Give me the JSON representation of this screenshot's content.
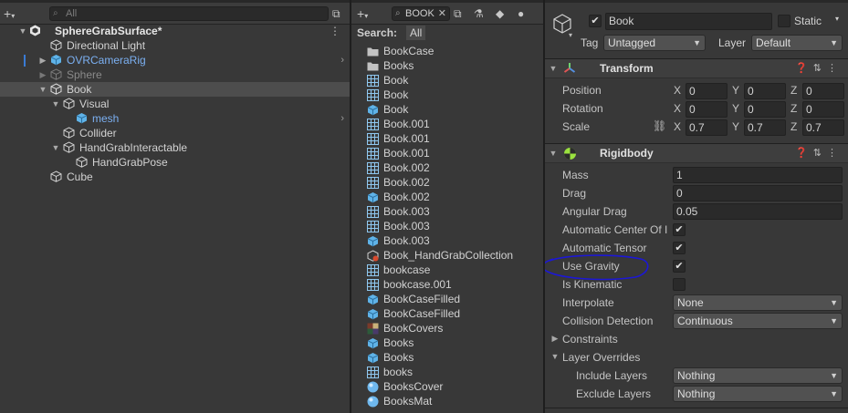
{
  "hierarchy": {
    "search_placeholder": "All",
    "scene_name": "SphereGrabSurface*",
    "items": [
      {
        "label": "Directional Light"
      },
      {
        "label": "OVRCameraRig"
      },
      {
        "label": "Sphere"
      },
      {
        "label": "Book"
      },
      {
        "label": "Visual"
      },
      {
        "label": "mesh"
      },
      {
        "label": "Collider"
      },
      {
        "label": "HandGrabInteractable"
      },
      {
        "label": "HandGrabPose"
      },
      {
        "label": "Cube"
      }
    ]
  },
  "project": {
    "search_value": "BOOK",
    "search_label": "Search:",
    "search_scope": "All",
    "items": [
      {
        "label": "BookCase",
        "icon": "folder-icon"
      },
      {
        "label": "Books",
        "icon": "folder-icon"
      },
      {
        "label": "Book",
        "icon": "mesh-grid-icon"
      },
      {
        "label": "Book",
        "icon": "mesh-grid-icon"
      },
      {
        "label": "Book",
        "icon": "prefab-cube-icon"
      },
      {
        "label": "Book.001",
        "icon": "mesh-grid-icon"
      },
      {
        "label": "Book.001",
        "icon": "mesh-grid-icon"
      },
      {
        "label": "Book.001",
        "icon": "mesh-grid-icon"
      },
      {
        "label": "Book.002",
        "icon": "mesh-grid-icon"
      },
      {
        "label": "Book.002",
        "icon": "mesh-grid-icon"
      },
      {
        "label": "Book.002",
        "icon": "prefab-cube-icon"
      },
      {
        "label": "Book.003",
        "icon": "mesh-grid-icon"
      },
      {
        "label": "Book.003",
        "icon": "mesh-grid-icon"
      },
      {
        "label": "Book.003",
        "icon": "prefab-cube-icon"
      },
      {
        "label": "Book_HandGrabCollection",
        "icon": "script-asset-icon"
      },
      {
        "label": "bookcase",
        "icon": "mesh-grid-icon"
      },
      {
        "label": "bookcase.001",
        "icon": "mesh-grid-icon"
      },
      {
        "label": "BookCaseFilled",
        "icon": "prefab-cube-icon"
      },
      {
        "label": "BookCaseFilled",
        "icon": "prefab-cube-icon"
      },
      {
        "label": "BookCovers",
        "icon": "texture-icon"
      },
      {
        "label": "Books",
        "icon": "prefab-cube-icon"
      },
      {
        "label": "Books",
        "icon": "prefab-cube-icon"
      },
      {
        "label": "books",
        "icon": "mesh-grid-icon"
      },
      {
        "label": "BooksCover",
        "icon": "material-sphere-icon"
      },
      {
        "label": "BooksMat",
        "icon": "material-sphere-icon"
      }
    ]
  },
  "inspector": {
    "object_name": "Book",
    "static_label": "Static",
    "tag_label": "Tag",
    "tag_value": "Untagged",
    "layer_label": "Layer",
    "layer_value": "Default",
    "transform": {
      "title": "Transform",
      "position_label": "Position",
      "rotation_label": "Rotation",
      "scale_label": "Scale",
      "x": "X",
      "y": "Y",
      "z": "Z",
      "position": [
        "0",
        "0",
        "0"
      ],
      "rotation": [
        "0",
        "0",
        "0"
      ],
      "scale": [
        "0.7",
        "0.7",
        "0.7"
      ]
    },
    "rigidbody": {
      "title": "Rigidbody",
      "mass_label": "Mass",
      "mass": "1",
      "drag_label": "Drag",
      "drag": "0",
      "angular_drag_label": "Angular Drag",
      "angular_drag": "0.05",
      "auto_center_label": "Automatic Center Of I",
      "auto_tensor_label": "Automatic Tensor",
      "use_gravity_label": "Use Gravity",
      "is_kinematic_label": "Is Kinematic",
      "interpolate_label": "Interpolate",
      "interpolate": "None",
      "collision_label": "Collision Detection",
      "collision": "Continuous",
      "constraints_label": "Constraints",
      "layer_overrides_label": "Layer Overrides",
      "include_label": "Include Layers",
      "include": "Nothing",
      "exclude_label": "Exclude Layers",
      "exclude": "Nothing"
    }
  },
  "colors": {
    "selection": "#4d4d4d",
    "blue_text": "#7bb0f2",
    "annotation": "#1c17d6"
  }
}
